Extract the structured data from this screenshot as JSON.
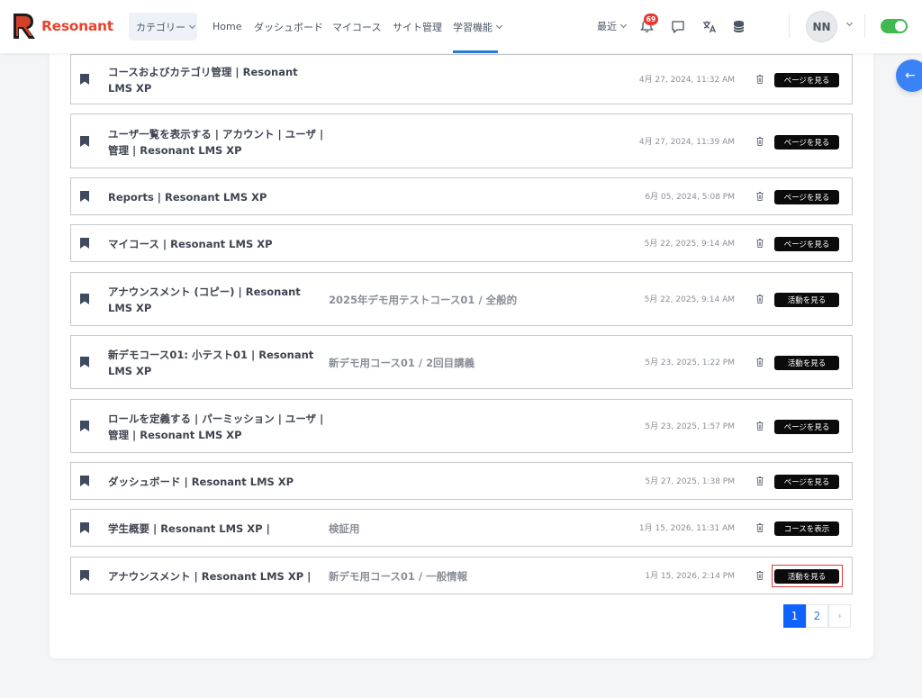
{
  "brand": {
    "name": "Resonant"
  },
  "nav": {
    "category": "カテゴリー",
    "home": "Home",
    "dashboard": "ダッシュボード",
    "mycourses": "マイコース",
    "site_admin": "サイト管理",
    "learning": "学習機能",
    "recent": "最近",
    "notification_count": "69",
    "user_initials": "NN"
  },
  "rows": [
    {
      "title": "コースおよびカテゴリ管理 | Resonant LMS XP",
      "course": "",
      "date": "4月 27, 2024, 11:32 AM",
      "action": "ページを見る"
    },
    {
      "title": "ユーザ一覧を表示する | アカウント | ユーザ | 管理 | Resonant LMS XP",
      "course": "",
      "date": "4月 27, 2024, 11:39 AM",
      "action": "ページを見る"
    },
    {
      "title": "Reports | Resonant LMS XP",
      "course": "",
      "date": "6月 05, 2024, 5:08 PM",
      "action": "ページを見る"
    },
    {
      "title": "マイコース | Resonant LMS XP",
      "course": "",
      "date": "5月 22, 2025, 9:14 AM",
      "action": "ページを見る"
    },
    {
      "title": "アナウンスメント (コピー) | Resonant LMS XP",
      "course": "2025年デモ用テストコース01 / 全般的",
      "date": "5月 22, 2025, 9:14 AM",
      "action": "活動を見る"
    },
    {
      "title": "新デモコース01: 小テスト01 | Resonant LMS XP",
      "course": "新デモ用コース01 / 2回目講義",
      "date": "5月 23, 2025, 1:22 PM",
      "action": "活動を見る"
    },
    {
      "title": "ロールを定義する | パーミッション | ユーザ | 管理 | Resonant LMS XP",
      "course": "",
      "date": "5月 23, 2025, 1:57 PM",
      "action": "ページを見る"
    },
    {
      "title": "ダッシュボード | Resonant LMS XP",
      "course": "",
      "date": "5月 27, 2025, 1:38 PM",
      "action": "ページを見る"
    },
    {
      "title": "学生概要 | Resonant LMS XP |",
      "course": "検証用",
      "date": "1月 15, 2026, 11:31 AM",
      "action": "コースを表示"
    },
    {
      "title": "アナウンスメント | Resonant LMS XP |",
      "course": "新デモ用コース01 / 一般情報",
      "date": "1月 15, 2026, 2:14 PM",
      "action": "活動を見る"
    }
  ],
  "pagination": {
    "pages": [
      "1",
      "2"
    ],
    "current": "1",
    "next": "›"
  },
  "colors": {
    "brand": "#e8452c",
    "accent": "#0f62fe",
    "toggle": "#3fb950",
    "highlight": "#e53935"
  }
}
